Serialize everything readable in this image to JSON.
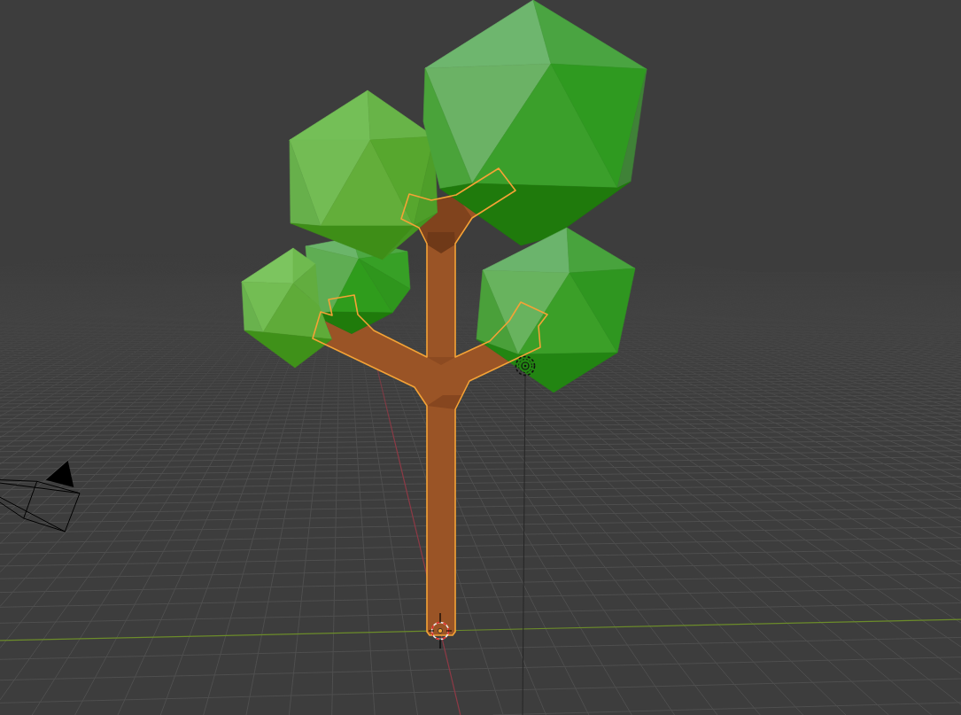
{
  "viewport": {
    "objects": [
      {
        "kind": "foliage",
        "selected": false
      },
      {
        "kind": "foliage",
        "selected": false
      },
      {
        "kind": "foliage",
        "selected": false
      },
      {
        "kind": "foliage",
        "selected": false
      },
      {
        "kind": "foliage",
        "selected": false
      },
      {
        "kind": "trunk",
        "selected": true
      },
      {
        "kind": "light",
        "selected": false
      },
      {
        "kind": "camera",
        "selected": false
      }
    ]
  }
}
